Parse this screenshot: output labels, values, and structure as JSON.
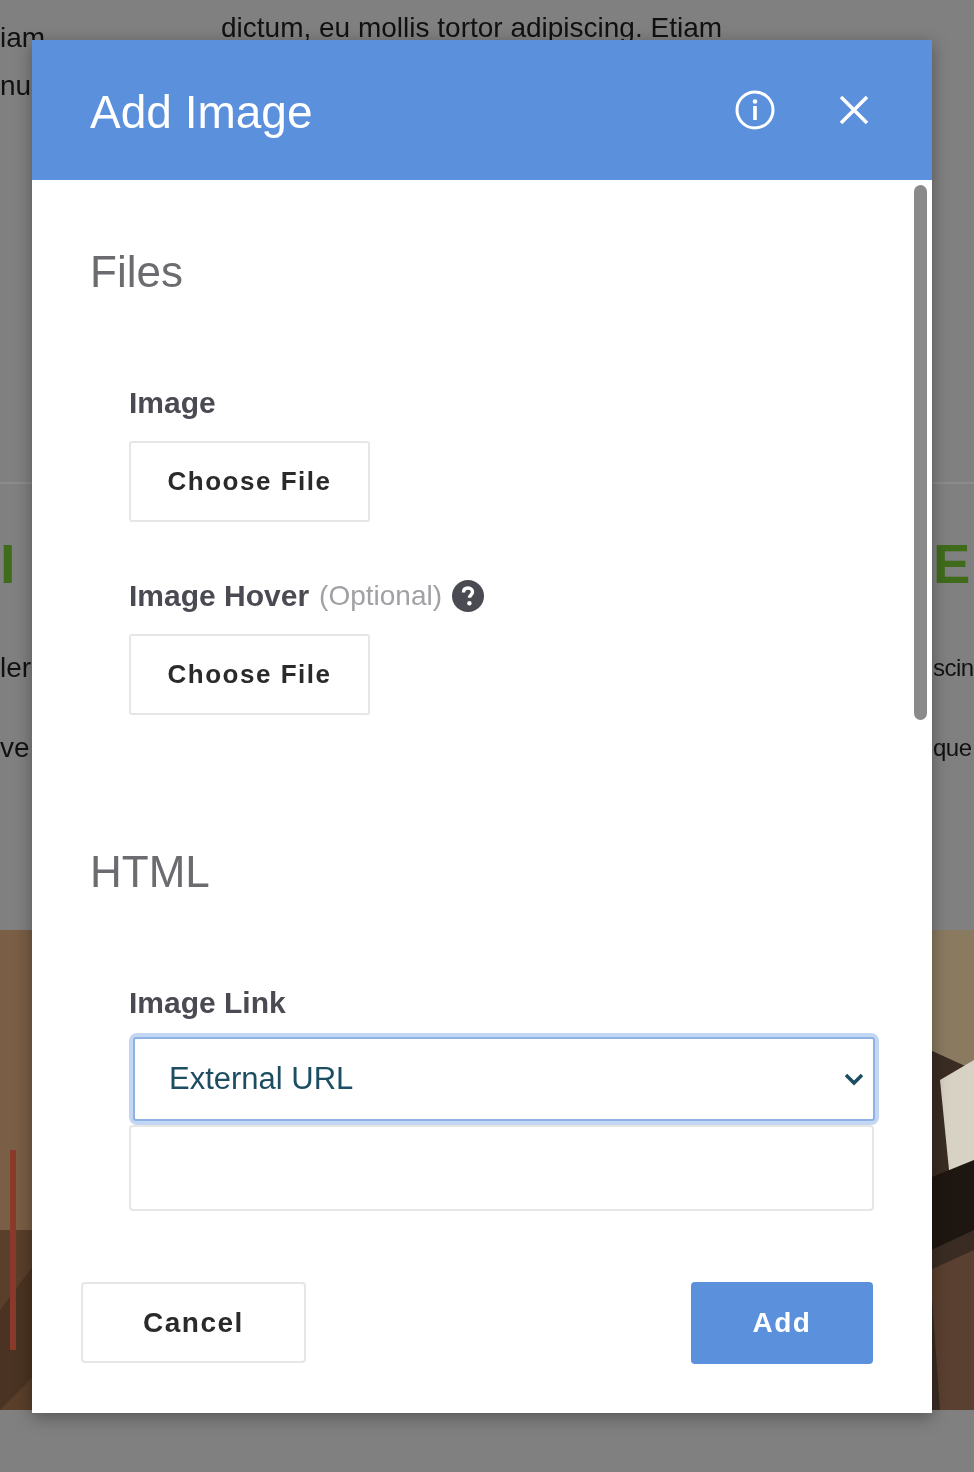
{
  "background": {
    "top_text": "dictum, eu mollis tortor adipiscing. Etiam",
    "left_texts": [
      {
        "text": "iam",
        "kind": "body"
      },
      {
        "text": "nu",
        "kind": "body"
      },
      {
        "text": "I",
        "kind": "heading"
      },
      {
        "text": "ler",
        "kind": "body"
      },
      {
        "text": "ve",
        "kind": "body"
      }
    ],
    "right_texts": [
      {
        "text": "E",
        "kind": "heading"
      },
      {
        "text": "scin",
        "kind": "body"
      },
      {
        "text": "que",
        "kind": "body"
      }
    ]
  },
  "dialog": {
    "title": "Add Image",
    "sections": [
      {
        "heading": "Files",
        "fields": [
          {
            "kind": "file",
            "label": "Image",
            "button": "Choose File",
            "help": false
          },
          {
            "kind": "file",
            "label": "Image Hover",
            "note": "(Optional)",
            "button": "Choose File",
            "help": true
          }
        ]
      },
      {
        "heading": "HTML",
        "fields": [
          {
            "kind": "select",
            "label": "Image Link",
            "value": "External URL",
            "focused": true
          },
          {
            "kind": "text"
          }
        ]
      }
    ],
    "buttons": [
      {
        "label": "Cancel",
        "primary": false
      },
      {
        "label": "Add",
        "primary": true
      }
    ]
  }
}
